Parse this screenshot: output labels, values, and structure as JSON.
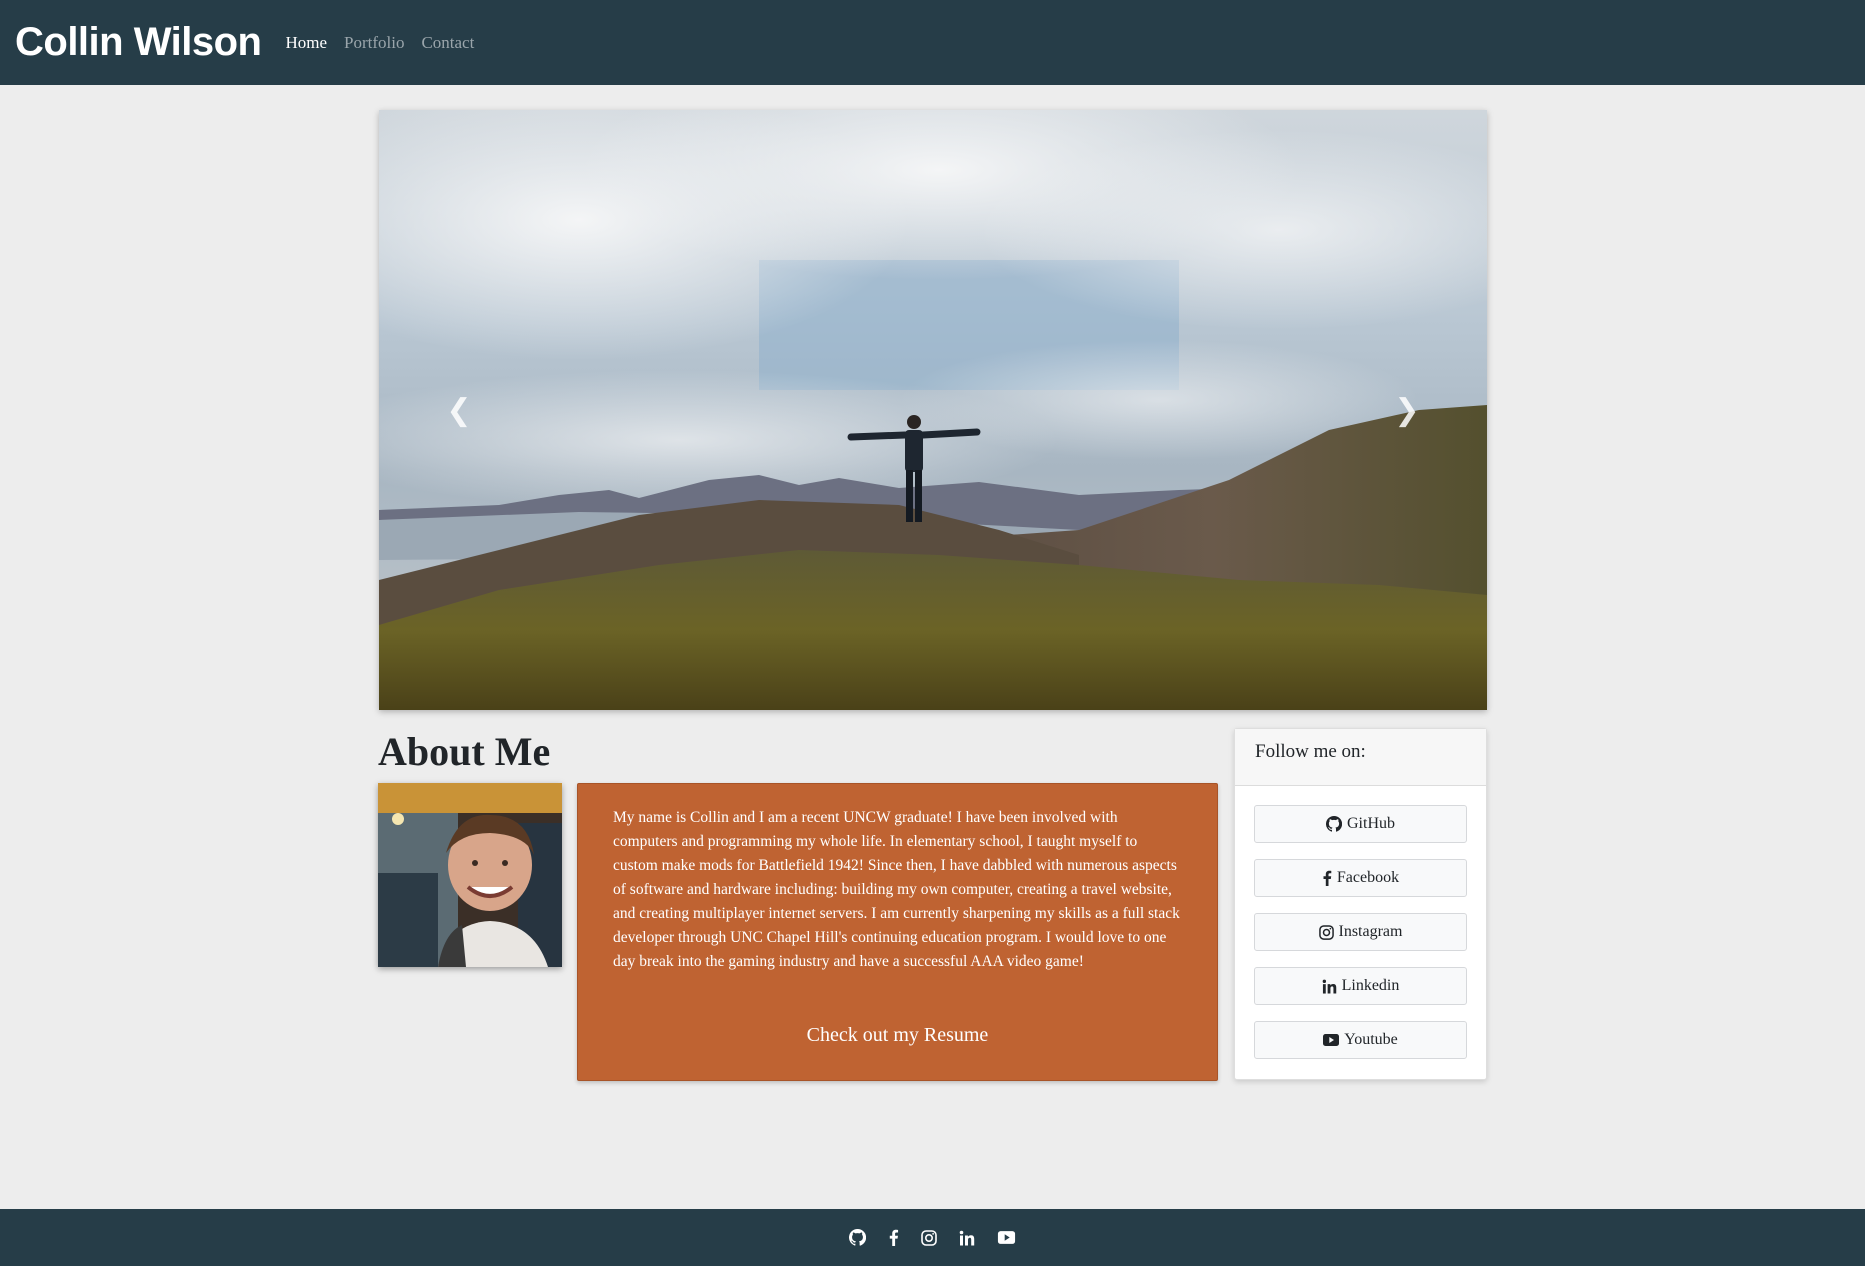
{
  "navbar": {
    "brand": "Collin Wilson",
    "links": [
      {
        "label": "Home",
        "active": true
      },
      {
        "label": "Portfolio",
        "active": false
      },
      {
        "label": "Contact",
        "active": false
      }
    ]
  },
  "carousel": {
    "prev_icon": "chevron-left-icon",
    "next_icon": "chevron-right-icon"
  },
  "about": {
    "title": "About Me",
    "text": "My name is Collin and I am a recent UNCW graduate! I have been involved with computers and programming my whole life. In elementary school, I taught myself to custom make mods for Battlefield 1942! Since then, I have dabbled with numerous aspects of software and hardware including: building my own computer, creating a travel website, and creating multiplayer internet servers. I am currently sharpening my skills as a full stack developer through UNC Chapel Hill's continuing education program. I would love to one day break into the gaming industry and have a successful AAA video game!",
    "resume_label": "Check out my Resume",
    "card_color": "#bf6332"
  },
  "follow": {
    "header": "Follow me on:",
    "buttons": [
      {
        "label": "GitHub",
        "icon": "github-icon"
      },
      {
        "label": "Facebook",
        "icon": "facebook-icon"
      },
      {
        "label": "Instagram",
        "icon": "instagram-icon"
      },
      {
        "label": "Linkedin",
        "icon": "linkedin-icon"
      },
      {
        "label": "Youtube",
        "icon": "youtube-icon"
      }
    ]
  },
  "footer": {
    "icons": [
      "github-icon",
      "facebook-icon",
      "instagram-icon",
      "linkedin-icon",
      "youtube-icon"
    ]
  },
  "colors": {
    "navbar": "#263d48",
    "background": "#ededed",
    "accent": "#bf6332"
  }
}
